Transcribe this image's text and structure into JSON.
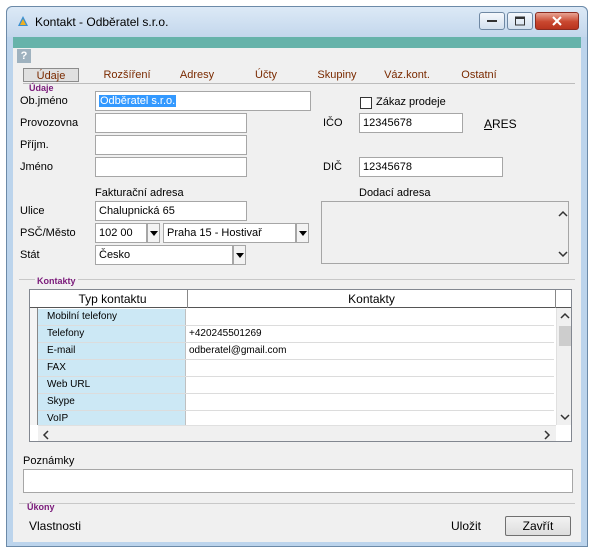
{
  "window": {
    "title": "Kontakt - Odběratel s.r.o."
  },
  "tabs": [
    "Údaje",
    "Rozšíření",
    "Adresy",
    "Účty",
    "Skupiny",
    "Váz.kont.",
    "Ostatní"
  ],
  "sections": {
    "udaje": "Údaje",
    "kontakty": "Kontakty",
    "ukony": "Úkony"
  },
  "form": {
    "obj_jmeno_label": "Ob.jméno",
    "obj_jmeno_value": "Odběratel s.r.o.",
    "provozovna_label": "Provozovna",
    "provozovna_value": "",
    "prijm_label": "Příjm.",
    "prijm_value": "",
    "jmeno_label": "Jméno",
    "jmeno_value": "",
    "zakaz_prodeje_label": "Zákaz prodeje",
    "zakaz_prodeje_checked": false,
    "ico_label": "IČO",
    "ico_value": "12345678",
    "ares_label": "ARES",
    "dic_label": "DIČ",
    "dic_value": "12345678",
    "fakturacni_adresa_label": "Fakturační adresa",
    "dodaci_adresa_label": "Dodací adresa",
    "dodaci_adresa_value": "",
    "ulice_label": "Ulice",
    "ulice_value": "Chalupnická 65",
    "psc_mesto_label": "PSČ/Město",
    "psc_value": "102 00",
    "mesto_value": "Praha 15 - Hostivař",
    "stat_label": "Stát",
    "stat_value": "Česko"
  },
  "contacts_table": {
    "headers": [
      "Typ kontaktu",
      "Kontakty"
    ],
    "rows": [
      {
        "type": "Mobilní telefony",
        "value": ""
      },
      {
        "type": "Telefony",
        "value": "+420245501269"
      },
      {
        "type": "E-mail",
        "value": "odberatel@gmail.com"
      },
      {
        "type": "FAX",
        "value": ""
      },
      {
        "type": "Web URL",
        "value": ""
      },
      {
        "type": "Skype",
        "value": ""
      },
      {
        "type": "VoIP",
        "value": ""
      }
    ]
  },
  "poznamky": {
    "label": "Poznámky",
    "value": ""
  },
  "footer": {
    "vlastnosti_label": "Vlastnosti",
    "ulozit_label": "Uložit",
    "zavrit_label": "Zavřít"
  },
  "colors": {
    "accent_bar": "#66b3aa",
    "section_label": "#7a1a7a",
    "tab_text": "#7a2a00",
    "grid_type_bg": "#cce8f5",
    "selection": "#3399ff"
  }
}
